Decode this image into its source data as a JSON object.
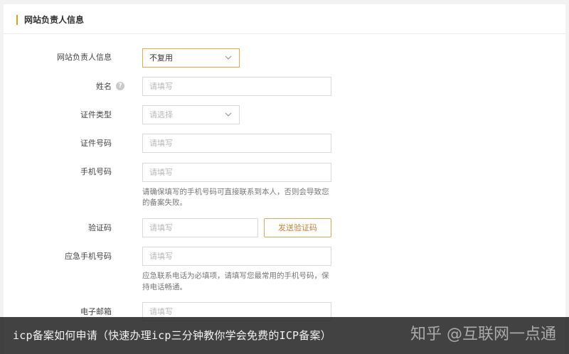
{
  "section": {
    "title": "网站负责人信息"
  },
  "form": {
    "reuse": {
      "label": "网站负责人信息",
      "value": "不复用"
    },
    "name": {
      "label": "姓名",
      "help": "?",
      "placeholder": "请填写"
    },
    "cert_type": {
      "label": "证件类型",
      "placeholder": "请选择"
    },
    "cert_no": {
      "label": "证件号码",
      "placeholder": "请填写"
    },
    "phone": {
      "label": "手机号码",
      "placeholder": "请填写",
      "hint_line1": "请确保填写的手机号码可直接联系到本人，否则会导致您",
      "hint_line2": "的备案失败。"
    },
    "code": {
      "label": "验证码",
      "placeholder": "请填写",
      "button": "发送验证码"
    },
    "emergency": {
      "label": "应急手机号码",
      "placeholder": "请填写",
      "hint_line1": "应急联系电话为必填项，请填写您最常用的手机号码，保",
      "hint_line2": "持电话畅通。"
    },
    "email": {
      "label": "电子邮箱",
      "placeholder": "请填写"
    }
  },
  "caption": "icp备案如何申请（快速办理icp三分钟教你学会免费的ICP备案）",
  "watermark": "知乎 @互联网一点通",
  "colors": {
    "accent": "#e39a2a",
    "button_text": "#c98336"
  }
}
